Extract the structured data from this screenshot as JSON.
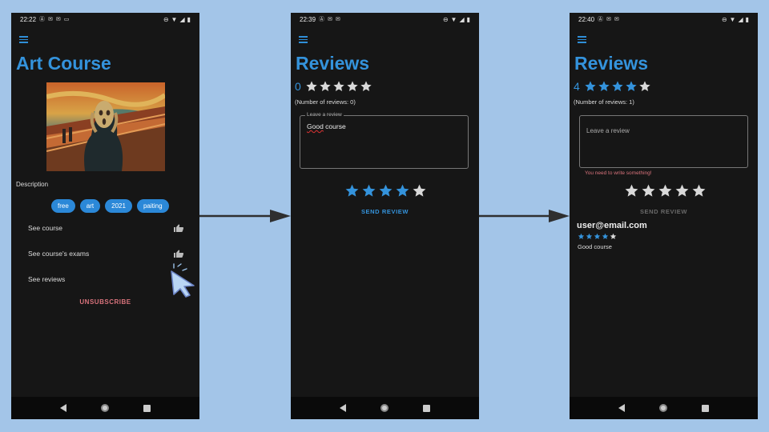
{
  "colors": {
    "background": "#a3c5e8",
    "screen": "#161616",
    "accent": "#3493dc",
    "star_inactive": "#d9d9d9",
    "error": "#d9737c"
  },
  "screen1": {
    "status_time": "22:22",
    "title": "Art Course",
    "description_label": "Description",
    "tags": [
      "free",
      "art",
      "2021",
      "paiting"
    ],
    "menu_items": [
      "See course",
      "See course's exams",
      "See reviews"
    ],
    "unsubscribe_label": "UNSUBSCRIBE"
  },
  "screen2": {
    "status_time": "22:39",
    "title": "Reviews",
    "rating_value": "0",
    "rating_stars": 0,
    "num_reviews_text": "(Number of reviews: 0)",
    "review_input": {
      "legend": "Leave a review",
      "value_word1": "Good",
      "value_rest": " course"
    },
    "selected_stars": 4,
    "send_label": "SEND REVIEW"
  },
  "screen3": {
    "status_time": "22:40",
    "title": "Reviews",
    "rating_value": "4",
    "rating_stars": 4,
    "num_reviews_text": "(Number of reviews: 1)",
    "review_input": {
      "placeholder": "Leave a review"
    },
    "error_text": "You need to write something!",
    "selected_stars": 0,
    "send_label": "SEND REVIEW",
    "review": {
      "user": "user@email.com",
      "stars": 4,
      "text": "Good course"
    }
  }
}
